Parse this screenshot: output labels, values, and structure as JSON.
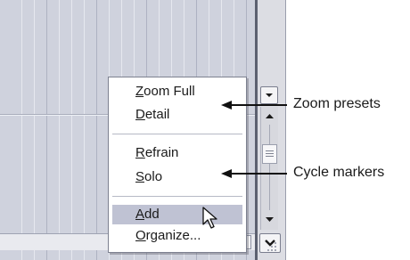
{
  "zoom_menu": {
    "items": [
      {
        "label_prefix": "",
        "label_mnemonic": "Z",
        "label_rest": "oom Full"
      },
      {
        "label_prefix": "",
        "label_mnemonic": "D",
        "label_rest": "etail"
      },
      {
        "label_prefix": "",
        "label_mnemonic": "R",
        "label_rest": "efrain"
      },
      {
        "label_prefix": "",
        "label_mnemonic": "S",
        "label_rest": "olo"
      },
      {
        "label_prefix": "",
        "label_mnemonic": "A",
        "label_rest": "dd"
      },
      {
        "label_prefix": "",
        "label_mnemonic": "O",
        "label_rest": "rganize..."
      }
    ]
  },
  "callouts": {
    "zoom_presets": "Zoom presets",
    "cycle_markers": "Cycle markers"
  },
  "icons": {
    "dropdown": "chevron-down-icon",
    "scroll_up": "arrow-up-icon",
    "scroll_down": "arrow-down-icon",
    "scroll_right": "arrow-right-icon",
    "cursor": "mouse-pointer-icon",
    "grip": "grip-icon"
  },
  "colors": {
    "highlight": "#bfc2d3",
    "grid_background": "#cfd2dd"
  }
}
